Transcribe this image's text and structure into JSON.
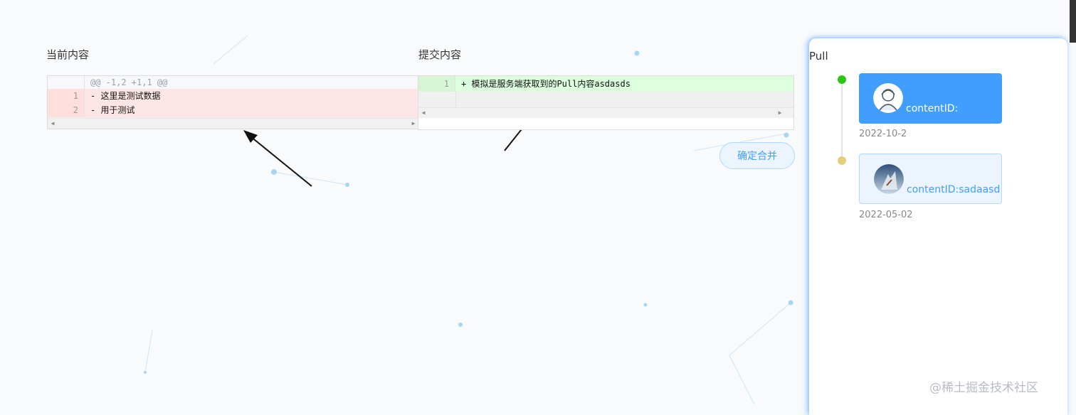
{
  "panels": {
    "left_title": "当前内容",
    "right_title": "提交内容"
  },
  "left_diff": {
    "hunk": "@@ -1,2 +1,1 @@",
    "lines": [
      {
        "num": "1",
        "text": "- 这里是测试数据"
      },
      {
        "num": "2",
        "text": "- 用于测试"
      }
    ]
  },
  "right_diff": {
    "lines": [
      {
        "num": "1",
        "text": "+ 模拟是服务端获取到的Pull内容asdasds"
      }
    ]
  },
  "merge_button_label": "确定合并",
  "side": {
    "title": "Pull",
    "items": [
      {
        "content_label": "contentID:",
        "content_value": "",
        "date": "2022-10-2",
        "dot_color": "#2ec315"
      },
      {
        "content_label": "contentID:",
        "content_value": "sadaasd",
        "date": "2022-05-02",
        "dot_color": "#e6cf7a"
      }
    ]
  },
  "watermark": "@稀土掘金技术社区",
  "colors": {
    "primary": "#409eff",
    "deleted_bg": "#ffe6e6",
    "added_bg": "#ddffdd"
  }
}
